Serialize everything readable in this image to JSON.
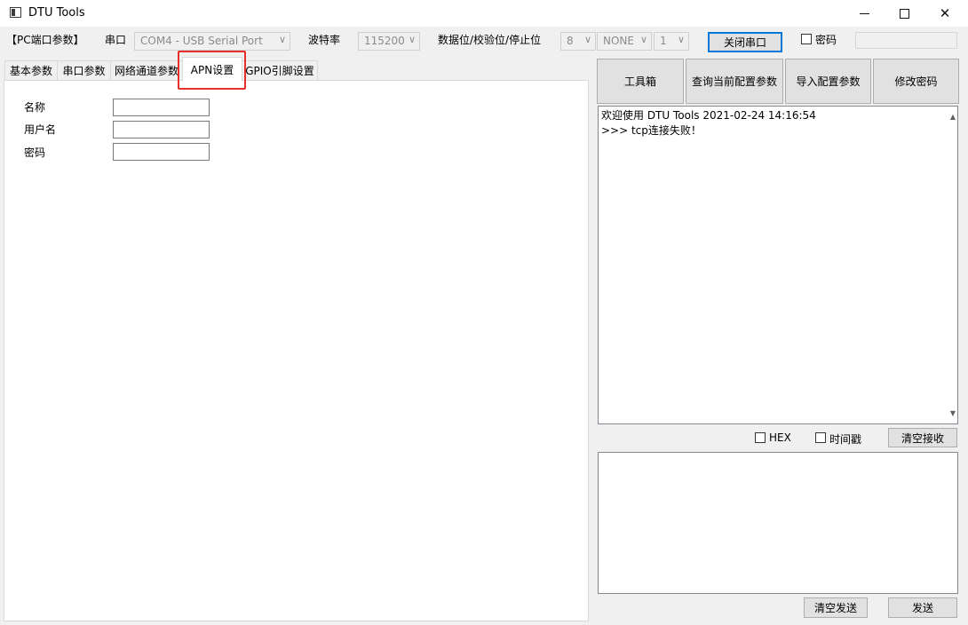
{
  "window": {
    "title": "DTU Tools"
  },
  "toolbar": {
    "section_label": "【PC端口参数】",
    "port_label": "串口",
    "port_value": "COM4 - USB Serial Port",
    "baud_label": "波特率",
    "baud_value": "115200",
    "format_label": "数据位/校验位/停止位",
    "databits_value": "8",
    "parity_value": "NONE",
    "stopbits_value": "1",
    "close_port_label": "关闭串口",
    "password_label": "密码"
  },
  "tabs": [
    {
      "label": "基本参数"
    },
    {
      "label": "串口参数"
    },
    {
      "label": "网络通道参数"
    },
    {
      "label": "APN设置"
    },
    {
      "label": "GPIO引脚设置"
    }
  ],
  "apn_form": {
    "name_label": "名称",
    "username_label": "用户名",
    "password_label": "密码"
  },
  "side_actions": {
    "toolbox": "工具箱",
    "query_config": "查询当前配置参数",
    "import_config": "导入配置参数",
    "change_password": "修改密码"
  },
  "log": {
    "line1": "欢迎使用 DTU Tools 2021-02-24 14:16:54",
    "line2": ">>> tcp连接失败！"
  },
  "receive_options": {
    "hex_label": "HEX",
    "timestamp_label": "时间戳",
    "clear_receive_label": "清空接收"
  },
  "send_actions": {
    "clear_send_label": "清空发送",
    "send_label": "发送"
  },
  "colors": {
    "highlight": "#e8302a",
    "focus": "#0078d7"
  }
}
